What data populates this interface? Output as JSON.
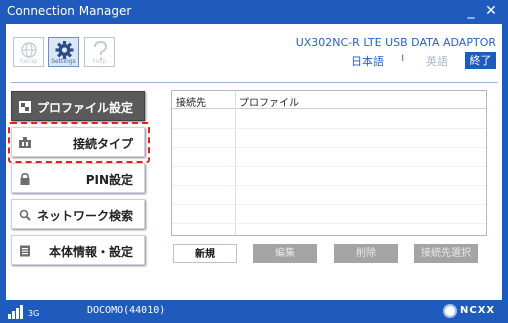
{
  "window": {
    "title": "Connection Manager",
    "minimize": "_",
    "close": "✕"
  },
  "toolbar": {
    "items": [
      {
        "label": "Setup",
        "icon": "globe-icon",
        "selected": false
      },
      {
        "label": "Settings",
        "icon": "gear-icon",
        "selected": true
      },
      {
        "label": "Help",
        "icon": "help-icon",
        "selected": false
      }
    ]
  },
  "device": {
    "name": "UX302NC-R LTE USB DATA ADAPTOR"
  },
  "language": {
    "japanese": "日本語",
    "separator": "I",
    "english": "英語"
  },
  "exit_label": "終了",
  "nav": [
    {
      "label": "プロファイル設定",
      "icon": "profile-icon",
      "active": true
    },
    {
      "label": "接続タイプ",
      "icon": "connection-type-icon",
      "active": false
    },
    {
      "label": "PIN設定",
      "icon": "lock-icon",
      "active": false
    },
    {
      "label": "ネットワーク検索",
      "icon": "search-icon",
      "active": false
    },
    {
      "label": "本体情報・設定",
      "icon": "info-list-icon",
      "active": false
    }
  ],
  "list": {
    "columns": [
      "接続先",
      "プロファイル"
    ],
    "rows": []
  },
  "actions": [
    {
      "label": "新規",
      "enabled": true
    },
    {
      "label": "編集",
      "enabled": false
    },
    {
      "label": "削除",
      "enabled": false
    },
    {
      "label": "接続先選択",
      "enabled": false
    }
  ],
  "status": {
    "rat": "3G",
    "network": "DOCOMO(44010)",
    "logo_text": "NCXX"
  },
  "colors": {
    "brand_blue": "#1f5bbd",
    "active_nav": "#5a5a5a",
    "highlight": "#e02020",
    "disabled_button": "#a4a4a4"
  }
}
